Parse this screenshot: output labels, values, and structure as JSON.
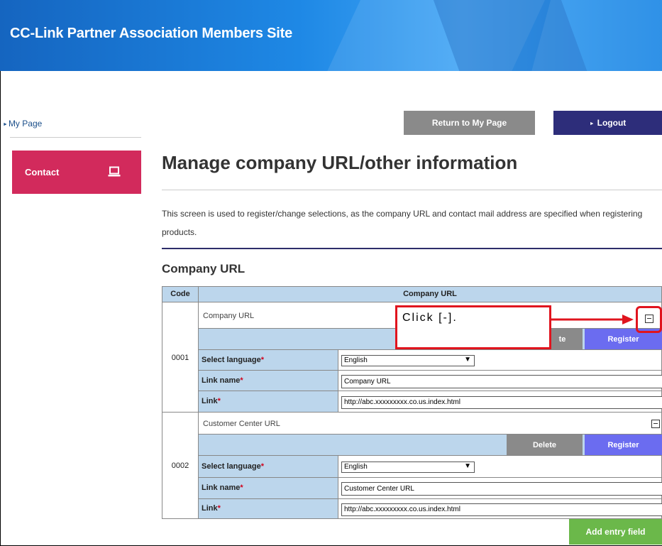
{
  "header": {
    "site_title": "CC-Link Partner Association Members Site"
  },
  "sidebar": {
    "my_page_label": "My Page",
    "contact_label": "Contact",
    "contact_icon": "laptop-icon"
  },
  "top_buttons": {
    "return_label": "Return to My Page",
    "logout_label": "Logout"
  },
  "main": {
    "page_title": "Manage company URL/other information",
    "description": "This screen is used to register/change selections, as the company URL and contact mail address are specified when registering products.",
    "section_title": "Company URL"
  },
  "table": {
    "headers": {
      "code": "Code",
      "company_url": "Company URL"
    },
    "entries": [
      {
        "code": "0001",
        "title": "Company URL",
        "language_label": "Select language",
        "language_value": "English",
        "link_name_label": "Link name",
        "link_name_value": "Company URL",
        "link_label": "Link",
        "link_value": "http://abc.xxxxxxxxx.co.us.index.html",
        "delete_label": "te",
        "register_label": "Register"
      },
      {
        "code": "0002",
        "title": "Customer Center URL",
        "language_label": "Select language",
        "language_value": "English",
        "link_name_label": "Link name",
        "link_name_value": "Customer Center URL",
        "link_label": "Link",
        "link_value": "http://abc.xxxxxxxxx.co.us.index.html",
        "delete_label": "Delete",
        "register_label": "Register"
      }
    ],
    "required_marker": "*",
    "add_label": "Add entry field"
  },
  "annotation": {
    "text": "Click [-]."
  },
  "colors": {
    "header_blue": "#1e88e5",
    "contact_pink": "#d22a5c",
    "logout_navy": "#2d2d7a",
    "table_blue": "#bcd6ec",
    "register_purple": "#6b6cf0",
    "add_green": "#6bb84a",
    "annotation_red": "#e0141e"
  }
}
